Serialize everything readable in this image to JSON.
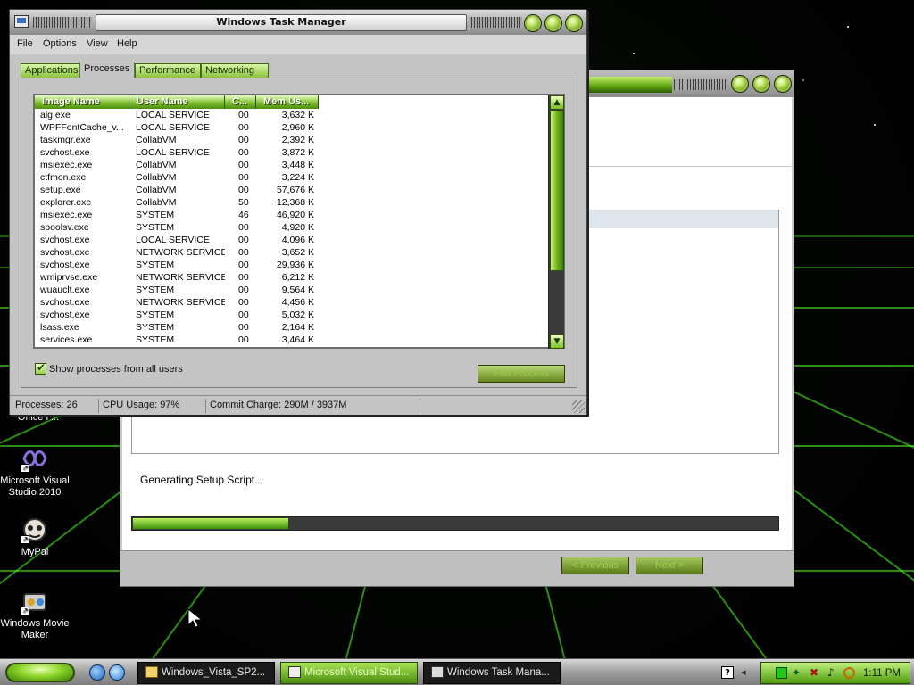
{
  "desktop": {
    "icons": [
      {
        "label": "Office F..."
      },
      {
        "label": "Microsoft Visual Studio 2010"
      },
      {
        "label": "MyPal"
      },
      {
        "label": "Windows Movie Maker"
      }
    ]
  },
  "setup_window": {
    "status_text": "Generating Setup Script...",
    "progress_fraction": 0.24,
    "prev_label": "< Previous",
    "next_label": "Next >"
  },
  "task_manager": {
    "title": "Windows Task Manager",
    "menu": [
      "File",
      "Options",
      "View",
      "Help"
    ],
    "tabs": [
      "Applications",
      "Processes",
      "Performance",
      "Networking"
    ],
    "active_tab": "Processes",
    "columns": [
      "Image Name",
      "User Name",
      "C...",
      "Mem Us..."
    ],
    "processes": [
      {
        "image": "alg.exe",
        "user": "LOCAL SERVICE",
        "cpu": "00",
        "mem": "3,632 K"
      },
      {
        "image": "WPFFontCache_v...",
        "user": "LOCAL SERVICE",
        "cpu": "00",
        "mem": "2,960 K"
      },
      {
        "image": "taskmgr.exe",
        "user": "CollabVM",
        "cpu": "00",
        "mem": "2,392 K"
      },
      {
        "image": "svchost.exe",
        "user": "LOCAL SERVICE",
        "cpu": "00",
        "mem": "3,872 K"
      },
      {
        "image": "msiexec.exe",
        "user": "CollabVM",
        "cpu": "00",
        "mem": "3,448 K"
      },
      {
        "image": "ctfmon.exe",
        "user": "CollabVM",
        "cpu": "00",
        "mem": "3,224 K"
      },
      {
        "image": "setup.exe",
        "user": "CollabVM",
        "cpu": "00",
        "mem": "57,676 K"
      },
      {
        "image": "explorer.exe",
        "user": "CollabVM",
        "cpu": "50",
        "mem": "12,368 K"
      },
      {
        "image": "msiexec.exe",
        "user": "SYSTEM",
        "cpu": "46",
        "mem": "46,920 K"
      },
      {
        "image": "spoolsv.exe",
        "user": "SYSTEM",
        "cpu": "00",
        "mem": "4,920 K"
      },
      {
        "image": "svchost.exe",
        "user": "LOCAL SERVICE",
        "cpu": "00",
        "mem": "4,096 K"
      },
      {
        "image": "svchost.exe",
        "user": "NETWORK SERVICE",
        "cpu": "00",
        "mem": "3,652 K"
      },
      {
        "image": "svchost.exe",
        "user": "SYSTEM",
        "cpu": "00",
        "mem": "29,936 K"
      },
      {
        "image": "wmiprvse.exe",
        "user": "NETWORK SERVICE",
        "cpu": "00",
        "mem": "6,212 K"
      },
      {
        "image": "wuauclt.exe",
        "user": "SYSTEM",
        "cpu": "00",
        "mem": "9,564 K"
      },
      {
        "image": "svchost.exe",
        "user": "NETWORK SERVICE",
        "cpu": "00",
        "mem": "4,456 K"
      },
      {
        "image": "svchost.exe",
        "user": "SYSTEM",
        "cpu": "00",
        "mem": "5,032 K"
      },
      {
        "image": "lsass.exe",
        "user": "SYSTEM",
        "cpu": "00",
        "mem": "2,164 K"
      },
      {
        "image": "services.exe",
        "user": "SYSTEM",
        "cpu": "00",
        "mem": "3,464 K"
      }
    ],
    "show_all_label": "Show processes from all users",
    "show_all_checked": true,
    "end_process_label": "End Process",
    "status": {
      "processes": "Processes: 26",
      "cpu": "CPU Usage: 97%",
      "commit": "Commit Charge: 290M / 3937M"
    }
  },
  "taskbar": {
    "tasks": [
      {
        "label": "Windows_Vista_SP2...",
        "active": false
      },
      {
        "label": "Microsoft Visual Stud...",
        "active": true
      },
      {
        "label": "Windows Task Mana...",
        "active": false
      }
    ],
    "help": "?",
    "clock": "1:11 PM"
  },
  "colors": {
    "accent_green": "#7fbd2e",
    "grid_green": "#5cff2a",
    "taskbar_gray": "#9e9e9e"
  }
}
